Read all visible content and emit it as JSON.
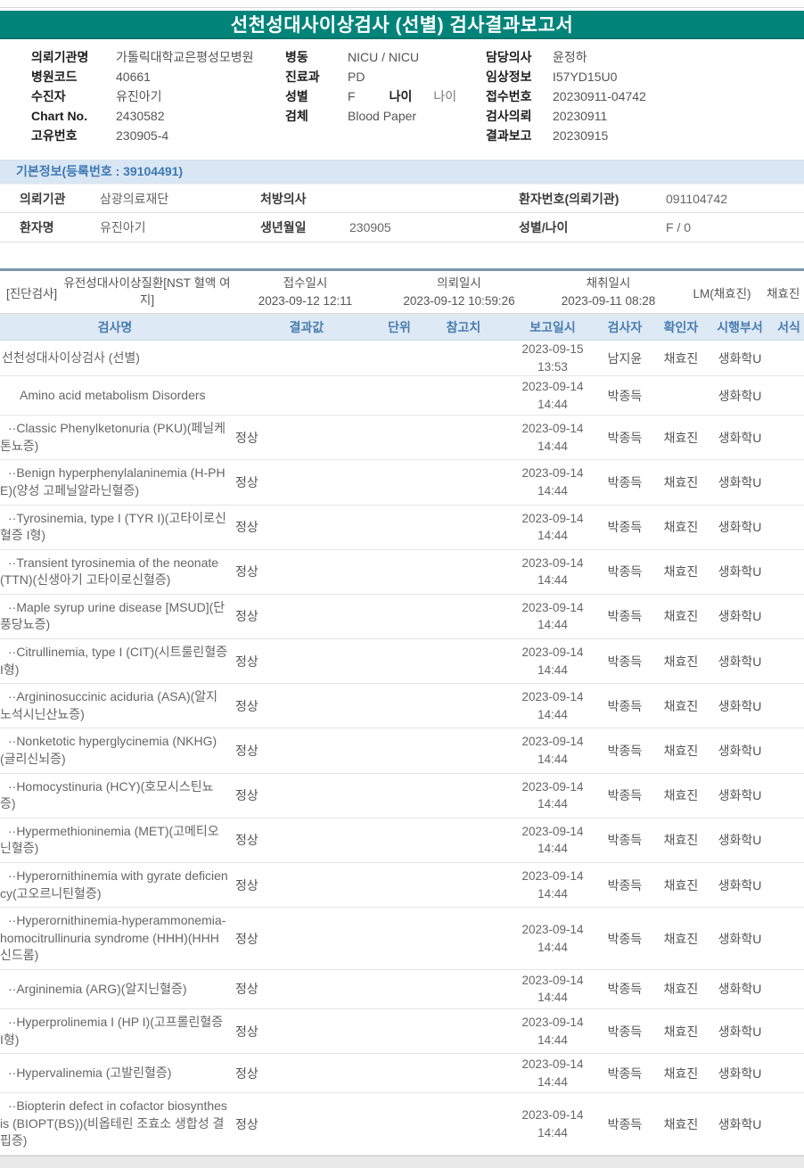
{
  "report": {
    "title": "선천성대사이상검사 (선별) 검사결과보고서"
  },
  "colors": {
    "title_bar_teal": "#00847A",
    "section_divider_slate": "#7D96AB",
    "table_header_bg": "#DDE9F4",
    "table_header_text": "#4A7DB0",
    "section_strip_bg": "#D9E6F3",
    "section_strip_text": "#3E79B4"
  },
  "patient_header": {
    "columns": [
      {
        "fields": [
          {
            "label": "의뢰기관명",
            "value": "가톨릭대학교은평성모병원"
          },
          {
            "label": "병원코드",
            "value": "40661"
          },
          {
            "label": "수진자",
            "value": "유진아기"
          },
          {
            "label": "Chart No.",
            "value": "2430582"
          },
          {
            "label": "고유번호",
            "value": "230905-4"
          }
        ]
      },
      {
        "fields": [
          {
            "label": "병동",
            "value": "NICU / NICU"
          },
          {
            "label": "진료과",
            "value": "PD"
          },
          {
            "label": "성별",
            "value": "F",
            "label2": "나이",
            "value2": "나이"
          },
          {
            "label": "검체",
            "value": "Blood Paper"
          }
        ]
      },
      {
        "fields": [
          {
            "label": "담당의사",
            "value": "윤정하"
          },
          {
            "label": "임상정보",
            "value": "I57YD15U0"
          },
          {
            "label": "접수번호",
            "value": "20230911-04742"
          },
          {
            "label": "검사의뢰",
            "value": "20230911"
          },
          {
            "label": "결과보고",
            "value": "20230915"
          }
        ]
      }
    ]
  },
  "basic_info": {
    "section_title": "기본정보(등록번호 : 39104491)",
    "rows": [
      {
        "cells": [
          {
            "label": "의뢰기관",
            "value": "삼광의료재단"
          },
          {
            "label": "처방의사",
            "value": ""
          },
          {
            "label": "환자번호(의뢰기관)",
            "value": "091104742"
          }
        ]
      },
      {
        "cells": [
          {
            "label": "환자명",
            "value": "유진아기"
          },
          {
            "label": "생년월일",
            "value": "230905"
          },
          {
            "label": "성별/나이",
            "value": "F / 0"
          }
        ]
      }
    ]
  },
  "order": {
    "tag": "[진단검사]",
    "name": "유전성대사이상질환[NST 혈액 여지]",
    "received_label": "접수일시",
    "received_value": "2023-09-12 12:11",
    "requested_label": "의뢰일시",
    "requested_value": "2023-09-12 10:59:26",
    "collected_label": "채취일시",
    "collected_value": "2023-09-11 08:28",
    "lm": "LM(채효진)",
    "collector": "채효진"
  },
  "results": {
    "headers": [
      "검사명",
      "결과값",
      "단위",
      "참고치",
      "보고일시",
      "검사자",
      "확인자",
      "시행부서",
      "서식"
    ],
    "rows": [
      {
        "name": "선천성대사이상검사 (선별)",
        "indent": 0,
        "result": "",
        "unit": "",
        "ref": "",
        "report_date": "2023-09-15",
        "report_time": "13:53",
        "tester": "남지윤",
        "confirmer": "채효진",
        "dept": "생화학U",
        "form": ""
      },
      {
        "name": "Amino acid metabolism Disorders",
        "indent": 1,
        "result": "",
        "unit": "",
        "ref": "",
        "report_date": "2023-09-14",
        "report_time": "14:44",
        "tester": "박종득",
        "confirmer": "",
        "dept": "생화학U",
        "form": ""
      },
      {
        "name": "··Classic Phenylketonuria (PKU)(페닐케톤뇨증)",
        "indent": 2,
        "result": "정상",
        "unit": "",
        "ref": "",
        "report_date": "2023-09-14",
        "report_time": "14:44",
        "tester": "박종득",
        "confirmer": "채효진",
        "dept": "생화학U",
        "form": ""
      },
      {
        "name": "··Benign hyperphenylalaninemia (H-PHE)(양성 고페닐알라닌혈증)",
        "indent": 2,
        "result": "정상",
        "unit": "",
        "ref": "",
        "report_date": "2023-09-14",
        "report_time": "14:44",
        "tester": "박종득",
        "confirmer": "채효진",
        "dept": "생화학U",
        "form": ""
      },
      {
        "name": "··Tyrosinemia, type I (TYR I)(고타이로신혈증 I형)",
        "indent": 2,
        "result": "정상",
        "unit": "",
        "ref": "",
        "report_date": "2023-09-14",
        "report_time": "14:44",
        "tester": "박종득",
        "confirmer": "채효진",
        "dept": "생화학U",
        "form": ""
      },
      {
        "name": "··Transient tyrosinemia of the neonate (TTN)(신생아기 고타이로신혈증)",
        "indent": 2,
        "result": "정상",
        "unit": "",
        "ref": "",
        "report_date": "2023-09-14",
        "report_time": "14:44",
        "tester": "박종득",
        "confirmer": "채효진",
        "dept": "생화학U",
        "form": ""
      },
      {
        "name": "··Maple syrup urine disease [MSUD](단풍당뇨증)",
        "indent": 2,
        "result": "정상",
        "unit": "",
        "ref": "",
        "report_date": "2023-09-14",
        "report_time": "14:44",
        "tester": "박종득",
        "confirmer": "채효진",
        "dept": "생화학U",
        "form": ""
      },
      {
        "name": "··Citrullinemia, type I (CIT)(시트룰린혈증 I형)",
        "indent": 2,
        "result": "정상",
        "unit": "",
        "ref": "",
        "report_date": "2023-09-14",
        "report_time": "14:44",
        "tester": "박종득",
        "confirmer": "채효진",
        "dept": "생화학U",
        "form": ""
      },
      {
        "name": "··Argininosuccinic aciduria (ASA)(알지노석시닌산뇨증)",
        "indent": 2,
        "result": "정상",
        "unit": "",
        "ref": "",
        "report_date": "2023-09-14",
        "report_time": "14:44",
        "tester": "박종득",
        "confirmer": "채효진",
        "dept": "생화학U",
        "form": ""
      },
      {
        "name": "··Nonketotic hyperglycinemia (NKHG)(글리신뇌증)",
        "indent": 2,
        "result": "정상",
        "unit": "",
        "ref": "",
        "report_date": "2023-09-14",
        "report_time": "14:44",
        "tester": "박종득",
        "confirmer": "채효진",
        "dept": "생화학U",
        "form": ""
      },
      {
        "name": "··Homocystinuria (HCY)(호모시스틴뇨증)",
        "indent": 2,
        "result": "정상",
        "unit": "",
        "ref": "",
        "report_date": "2023-09-14",
        "report_time": "14:44",
        "tester": "박종득",
        "confirmer": "채효진",
        "dept": "생화학U",
        "form": ""
      },
      {
        "name": "··Hypermethioninemia (MET)(고메티오닌혈증)",
        "indent": 2,
        "result": "정상",
        "unit": "",
        "ref": "",
        "report_date": "2023-09-14",
        "report_time": "14:44",
        "tester": "박종득",
        "confirmer": "채효진",
        "dept": "생화학U",
        "form": ""
      },
      {
        "name": "··Hyperornithinemia with gyrate deficiency(고오르니틴혈증)",
        "indent": 2,
        "result": "정상",
        "unit": "",
        "ref": "",
        "report_date": "2023-09-14",
        "report_time": "14:44",
        "tester": "박종득",
        "confirmer": "채효진",
        "dept": "생화학U",
        "form": ""
      },
      {
        "name": "··Hyperornithinemia-hyperammonemia-homocitrullinuria syndrome (HHH)(HHH신드롬)",
        "indent": 2,
        "result": "정상",
        "unit": "",
        "ref": "",
        "report_date": "2023-09-14",
        "report_time": "14:44",
        "tester": "박종득",
        "confirmer": "채효진",
        "dept": "생화학U",
        "form": ""
      },
      {
        "name": "··Argininemia (ARG)(알지닌혈증)",
        "indent": 2,
        "result": "정상",
        "unit": "",
        "ref": "",
        "report_date": "2023-09-14",
        "report_time": "14:44",
        "tester": "박종득",
        "confirmer": "채효진",
        "dept": "생화학U",
        "form": ""
      },
      {
        "name": "··Hyperprolinemia I (HP I)(고프롤린혈증 I형)",
        "indent": 2,
        "result": "정상",
        "unit": "",
        "ref": "",
        "report_date": "2023-09-14",
        "report_time": "14:44",
        "tester": "박종득",
        "confirmer": "채효진",
        "dept": "생화학U",
        "form": ""
      },
      {
        "name": "··Hypervalinemia (고발린혈증)",
        "indent": 2,
        "result": "정상",
        "unit": "",
        "ref": "",
        "report_date": "2023-09-14",
        "report_time": "14:44",
        "tester": "박종득",
        "confirmer": "채효진",
        "dept": "생화학U",
        "form": ""
      },
      {
        "name": "··Biopterin defect in cofactor biosynthesis (BIOPT(BS))(비옵테린 조효소 생합성 결핍증)",
        "indent": 2,
        "result": "정상",
        "unit": "",
        "ref": "",
        "report_date": "2023-09-14",
        "report_time": "14:44",
        "tester": "박종득",
        "confirmer": "채효진",
        "dept": "생화학U",
        "form": ""
      }
    ]
  }
}
